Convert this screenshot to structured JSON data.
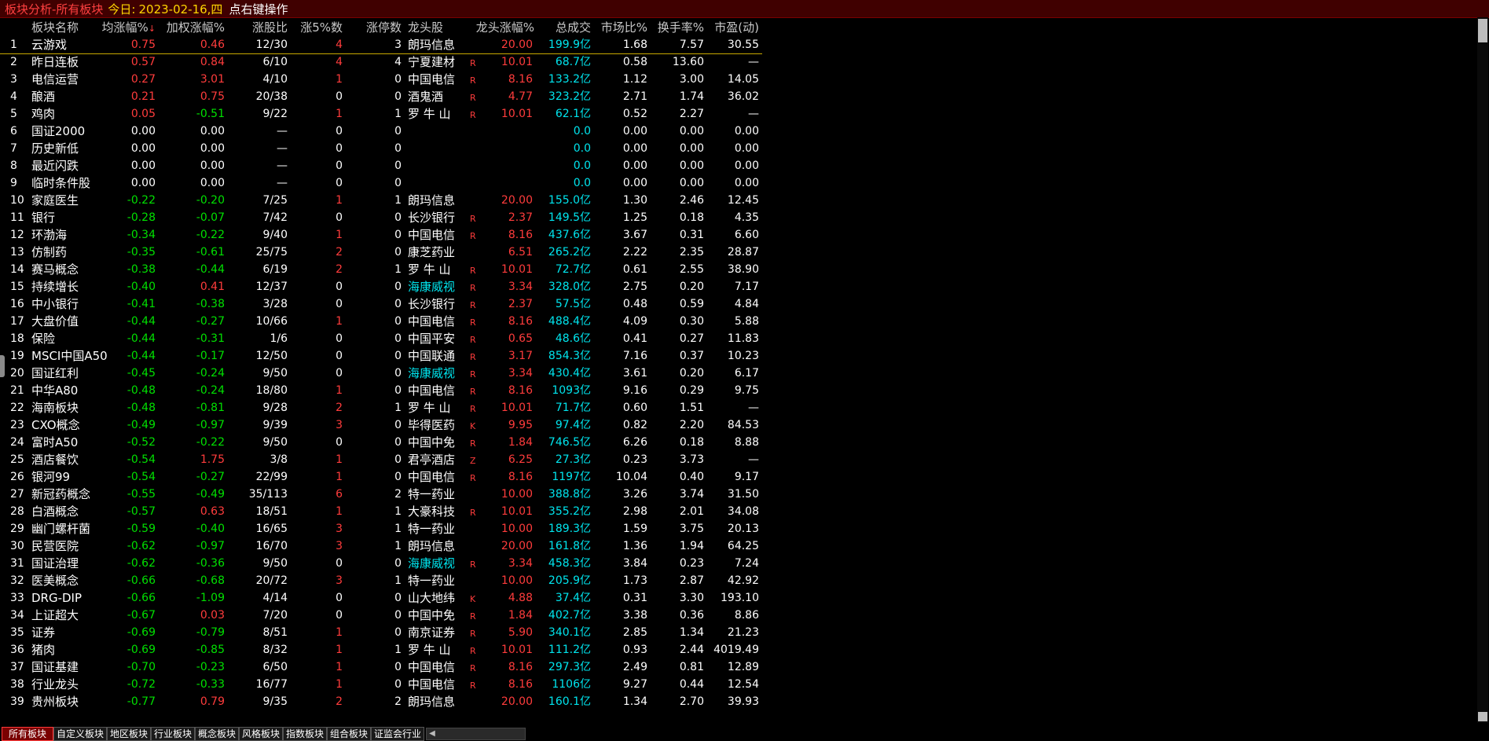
{
  "title": {
    "module": "板块分析-所有板块",
    "today_label": "今日:",
    "today_value": "2023-02-16,四",
    "hint": "点右键操作"
  },
  "columns": {
    "name": "板块名称",
    "avg": "均涨幅%",
    "weighted": "加权涨幅%",
    "ratio": "涨股比",
    "up5": "涨5%数",
    "limit_up": "涨停数",
    "leader": "龙头股",
    "leader_pct": "龙头涨幅%",
    "amount": "总成交",
    "mkt_ratio": "市场比%",
    "turnover": "换手率%",
    "pe": "市盈(动)"
  },
  "colors": {
    "up": "#ff3c3c",
    "down": "#00e000",
    "flat": "#ffffff",
    "amount": "#00e5ee",
    "leader_special": "#00e5ee"
  },
  "rows": [
    {
      "no": "1",
      "name": "云游戏",
      "avg": "0.75",
      "wgt": "0.46",
      "ratio": "12/30",
      "up5": "4",
      "lim": "3",
      "lead": "朗玛信息",
      "mark": "",
      "lpct": "20.00",
      "amt": "199.9亿",
      "mkt": "1.68",
      "turn": "7.57",
      "pe": "30.55"
    },
    {
      "no": "2",
      "name": "昨日连板",
      "avg": "0.57",
      "wgt": "0.84",
      "ratio": "6/10",
      "up5": "4",
      "lim": "4",
      "lead": "宁夏建材",
      "mark": "R",
      "lpct": "10.01",
      "amt": "68.7亿",
      "mkt": "0.58",
      "turn": "13.60",
      "pe": "—"
    },
    {
      "no": "3",
      "name": "电信运营",
      "avg": "0.27",
      "wgt": "3.01",
      "ratio": "4/10",
      "up5": "1",
      "lim": "0",
      "lead": "中国电信",
      "mark": "R",
      "lpct": "8.16",
      "amt": "133.2亿",
      "mkt": "1.12",
      "turn": "3.00",
      "pe": "14.05"
    },
    {
      "no": "4",
      "name": "酿酒",
      "avg": "0.21",
      "wgt": "0.75",
      "ratio": "20/38",
      "up5": "0",
      "lim": "0",
      "lead": "酒鬼酒",
      "mark": "R",
      "lpct": "4.77",
      "amt": "323.2亿",
      "mkt": "2.71",
      "turn": "1.74",
      "pe": "36.02"
    },
    {
      "no": "5",
      "name": "鸡肉",
      "avg": "0.05",
      "wgt": "-0.51",
      "ratio": "9/22",
      "up5": "1",
      "lim": "1",
      "lead": "罗 牛 山",
      "mark": "R",
      "lpct": "10.01",
      "amt": "62.1亿",
      "mkt": "0.52",
      "turn": "2.27",
      "pe": "—"
    },
    {
      "no": "6",
      "name": "国证2000",
      "avg": "0.00",
      "wgt": "0.00",
      "ratio": "—",
      "up5": "0",
      "lim": "0",
      "lead": "",
      "mark": "",
      "lpct": "",
      "amt": "0.0",
      "mkt": "0.00",
      "turn": "0.00",
      "pe": "0.00"
    },
    {
      "no": "7",
      "name": "历史新低",
      "avg": "0.00",
      "wgt": "0.00",
      "ratio": "—",
      "up5": "0",
      "lim": "0",
      "lead": "",
      "mark": "",
      "lpct": "",
      "amt": "0.0",
      "mkt": "0.00",
      "turn": "0.00",
      "pe": "0.00"
    },
    {
      "no": "8",
      "name": "最近闪跌",
      "avg": "0.00",
      "wgt": "0.00",
      "ratio": "—",
      "up5": "0",
      "lim": "0",
      "lead": "",
      "mark": "",
      "lpct": "",
      "amt": "0.0",
      "mkt": "0.00",
      "turn": "0.00",
      "pe": "0.00"
    },
    {
      "no": "9",
      "name": "临时条件股",
      "avg": "0.00",
      "wgt": "0.00",
      "ratio": "—",
      "up5": "0",
      "lim": "0",
      "lead": "",
      "mark": "",
      "lpct": "",
      "amt": "0.0",
      "mkt": "0.00",
      "turn": "0.00",
      "pe": "0.00"
    },
    {
      "no": "10",
      "name": "家庭医生",
      "avg": "-0.22",
      "wgt": "-0.20",
      "ratio": "7/25",
      "up5": "1",
      "lim": "1",
      "lead": "朗玛信息",
      "mark": "",
      "lpct": "20.00",
      "amt": "155.0亿",
      "mkt": "1.30",
      "turn": "2.46",
      "pe": "12.45"
    },
    {
      "no": "11",
      "name": "银行",
      "avg": "-0.28",
      "wgt": "-0.07",
      "ratio": "7/42",
      "up5": "0",
      "lim": "0",
      "lead": "长沙银行",
      "mark": "R",
      "lpct": "2.37",
      "amt": "149.5亿",
      "mkt": "1.25",
      "turn": "0.18",
      "pe": "4.35"
    },
    {
      "no": "12",
      "name": "环渤海",
      "avg": "-0.34",
      "wgt": "-0.22",
      "ratio": "9/40",
      "up5": "1",
      "lim": "0",
      "lead": "中国电信",
      "mark": "R",
      "lpct": "8.16",
      "amt": "437.6亿",
      "mkt": "3.67",
      "turn": "0.31",
      "pe": "6.60"
    },
    {
      "no": "13",
      "name": "仿制药",
      "avg": "-0.35",
      "wgt": "-0.61",
      "ratio": "25/75",
      "up5": "2",
      "lim": "0",
      "lead": "康芝药业",
      "mark": "",
      "lpct": "6.51",
      "amt": "265.2亿",
      "mkt": "2.22",
      "turn": "2.35",
      "pe": "28.87"
    },
    {
      "no": "14",
      "name": "赛马概念",
      "avg": "-0.38",
      "wgt": "-0.44",
      "ratio": "6/19",
      "up5": "2",
      "lim": "1",
      "lead": "罗 牛 山",
      "mark": "R",
      "lpct": "10.01",
      "amt": "72.7亿",
      "mkt": "0.61",
      "turn": "2.55",
      "pe": "38.90"
    },
    {
      "no": "15",
      "name": "持续增长",
      "avg": "-0.40",
      "wgt": "0.41",
      "ratio": "12/37",
      "up5": "0",
      "lim": "0",
      "lead": "海康威视",
      "mark": "R",
      "lpct": "3.34",
      "amt": "328.0亿",
      "mkt": "2.75",
      "turn": "0.20",
      "pe": "7.17"
    },
    {
      "no": "16",
      "name": "中小银行",
      "avg": "-0.41",
      "wgt": "-0.38",
      "ratio": "3/28",
      "up5": "0",
      "lim": "0",
      "lead": "长沙银行",
      "mark": "R",
      "lpct": "2.37",
      "amt": "57.5亿",
      "mkt": "0.48",
      "turn": "0.59",
      "pe": "4.84"
    },
    {
      "no": "17",
      "name": "大盘价值",
      "avg": "-0.44",
      "wgt": "-0.27",
      "ratio": "10/66",
      "up5": "1",
      "lim": "0",
      "lead": "中国电信",
      "mark": "R",
      "lpct": "8.16",
      "amt": "488.4亿",
      "mkt": "4.09",
      "turn": "0.30",
      "pe": "5.88"
    },
    {
      "no": "18",
      "name": "保险",
      "avg": "-0.44",
      "wgt": "-0.31",
      "ratio": "1/6",
      "up5": "0",
      "lim": "0",
      "lead": "中国平安",
      "mark": "R",
      "lpct": "0.65",
      "amt": "48.6亿",
      "mkt": "0.41",
      "turn": "0.27",
      "pe": "11.83"
    },
    {
      "no": "19",
      "name": "MSCI中国A50",
      "avg": "-0.44",
      "wgt": "-0.17",
      "ratio": "12/50",
      "up5": "0",
      "lim": "0",
      "lead": "中国联通",
      "mark": "R",
      "lpct": "3.17",
      "amt": "854.3亿",
      "mkt": "7.16",
      "turn": "0.37",
      "pe": "10.23"
    },
    {
      "no": "20",
      "name": "国证红利",
      "avg": "-0.45",
      "wgt": "-0.24",
      "ratio": "9/50",
      "up5": "0",
      "lim": "0",
      "lead": "海康威视",
      "mark": "R",
      "lpct": "3.34",
      "amt": "430.4亿",
      "mkt": "3.61",
      "turn": "0.20",
      "pe": "6.17"
    },
    {
      "no": "21",
      "name": "中华A80",
      "avg": "-0.48",
      "wgt": "-0.24",
      "ratio": "18/80",
      "up5": "1",
      "lim": "0",
      "lead": "中国电信",
      "mark": "R",
      "lpct": "8.16",
      "amt": "1093亿",
      "mkt": "9.16",
      "turn": "0.29",
      "pe": "9.75"
    },
    {
      "no": "22",
      "name": "海南板块",
      "avg": "-0.48",
      "wgt": "-0.81",
      "ratio": "9/28",
      "up5": "2",
      "lim": "1",
      "lead": "罗 牛 山",
      "mark": "R",
      "lpct": "10.01",
      "amt": "71.7亿",
      "mkt": "0.60",
      "turn": "1.51",
      "pe": "—"
    },
    {
      "no": "23",
      "name": "CXO概念",
      "avg": "-0.49",
      "wgt": "-0.97",
      "ratio": "9/39",
      "up5": "3",
      "lim": "0",
      "lead": "毕得医药",
      "mark": "K",
      "lpct": "9.95",
      "amt": "97.4亿",
      "mkt": "0.82",
      "turn": "2.20",
      "pe": "84.53"
    },
    {
      "no": "24",
      "name": "富时A50",
      "avg": "-0.52",
      "wgt": "-0.22",
      "ratio": "9/50",
      "up5": "0",
      "lim": "0",
      "lead": "中国中免",
      "mark": "R",
      "lpct": "1.84",
      "amt": "746.5亿",
      "mkt": "6.26",
      "turn": "0.18",
      "pe": "8.88"
    },
    {
      "no": "25",
      "name": "酒店餐饮",
      "avg": "-0.54",
      "wgt": "1.75",
      "ratio": "3/8",
      "up5": "1",
      "lim": "0",
      "lead": "君亭酒店",
      "mark": "Z",
      "lpct": "6.25",
      "amt": "27.3亿",
      "mkt": "0.23",
      "turn": "3.73",
      "pe": "—"
    },
    {
      "no": "26",
      "name": "银河99",
      "avg": "-0.54",
      "wgt": "-0.27",
      "ratio": "22/99",
      "up5": "1",
      "lim": "0",
      "lead": "中国电信",
      "mark": "R",
      "lpct": "8.16",
      "amt": "1197亿",
      "mkt": "10.04",
      "turn": "0.40",
      "pe": "9.17"
    },
    {
      "no": "27",
      "name": "新冠药概念",
      "avg": "-0.55",
      "wgt": "-0.49",
      "ratio": "35/113",
      "up5": "6",
      "lim": "2",
      "lead": "特一药业",
      "mark": "",
      "lpct": "10.00",
      "amt": "388.8亿",
      "mkt": "3.26",
      "turn": "3.74",
      "pe": "31.50"
    },
    {
      "no": "28",
      "name": "白酒概念",
      "avg": "-0.57",
      "wgt": "0.63",
      "ratio": "18/51",
      "up5": "1",
      "lim": "1",
      "lead": "大豪科技",
      "mark": "R",
      "lpct": "10.01",
      "amt": "355.2亿",
      "mkt": "2.98",
      "turn": "2.01",
      "pe": "34.08"
    },
    {
      "no": "29",
      "name": "幽门螺杆菌",
      "avg": "-0.59",
      "wgt": "-0.40",
      "ratio": "16/65",
      "up5": "3",
      "lim": "1",
      "lead": "特一药业",
      "mark": "",
      "lpct": "10.00",
      "amt": "189.3亿",
      "mkt": "1.59",
      "turn": "3.75",
      "pe": "20.13"
    },
    {
      "no": "30",
      "name": "民营医院",
      "avg": "-0.62",
      "wgt": "-0.97",
      "ratio": "16/70",
      "up5": "3",
      "lim": "1",
      "lead": "朗玛信息",
      "mark": "",
      "lpct": "20.00",
      "amt": "161.8亿",
      "mkt": "1.36",
      "turn": "1.94",
      "pe": "64.25"
    },
    {
      "no": "31",
      "name": "国证治理",
      "avg": "-0.62",
      "wgt": "-0.36",
      "ratio": "9/50",
      "up5": "0",
      "lim": "0",
      "lead": "海康威视",
      "mark": "R",
      "lpct": "3.34",
      "amt": "458.3亿",
      "mkt": "3.84",
      "turn": "0.23",
      "pe": "7.24"
    },
    {
      "no": "32",
      "name": "医美概念",
      "avg": "-0.66",
      "wgt": "-0.68",
      "ratio": "20/72",
      "up5": "3",
      "lim": "1",
      "lead": "特一药业",
      "mark": "",
      "lpct": "10.00",
      "amt": "205.9亿",
      "mkt": "1.73",
      "turn": "2.87",
      "pe": "42.92"
    },
    {
      "no": "33",
      "name": "DRG-DIP",
      "avg": "-0.66",
      "wgt": "-1.09",
      "ratio": "4/14",
      "up5": "0",
      "lim": "0",
      "lead": "山大地纬",
      "mark": "K",
      "lpct": "4.88",
      "amt": "37.4亿",
      "mkt": "0.31",
      "turn": "3.30",
      "pe": "193.10"
    },
    {
      "no": "34",
      "name": "上证超大",
      "avg": "-0.67",
      "wgt": "0.03",
      "ratio": "7/20",
      "up5": "0",
      "lim": "0",
      "lead": "中国中免",
      "mark": "R",
      "lpct": "1.84",
      "amt": "402.7亿",
      "mkt": "3.38",
      "turn": "0.36",
      "pe": "8.86"
    },
    {
      "no": "35",
      "name": "证券",
      "avg": "-0.69",
      "wgt": "-0.79",
      "ratio": "8/51",
      "up5": "1",
      "lim": "0",
      "lead": "南京证券",
      "mark": "R",
      "lpct": "5.90",
      "amt": "340.1亿",
      "mkt": "2.85",
      "turn": "1.34",
      "pe": "21.23"
    },
    {
      "no": "36",
      "name": "猪肉",
      "avg": "-0.69",
      "wgt": "-0.85",
      "ratio": "8/32",
      "up5": "1",
      "lim": "1",
      "lead": "罗 牛 山",
      "mark": "R",
      "lpct": "10.01",
      "amt": "111.2亿",
      "mkt": "0.93",
      "turn": "2.44",
      "pe": "4019.49"
    },
    {
      "no": "37",
      "name": "国证基建",
      "avg": "-0.70",
      "wgt": "-0.23",
      "ratio": "6/50",
      "up5": "1",
      "lim": "0",
      "lead": "中国电信",
      "mark": "R",
      "lpct": "8.16",
      "amt": "297.3亿",
      "mkt": "2.49",
      "turn": "0.81",
      "pe": "12.89"
    },
    {
      "no": "38",
      "name": "行业龙头",
      "avg": "-0.72",
      "wgt": "-0.33",
      "ratio": "16/77",
      "up5": "1",
      "lim": "0",
      "lead": "中国电信",
      "mark": "R",
      "lpct": "8.16",
      "amt": "1106亿",
      "mkt": "9.27",
      "turn": "0.44",
      "pe": "12.54"
    },
    {
      "no": "39",
      "name": "贵州板块",
      "avg": "-0.77",
      "wgt": "0.79",
      "ratio": "9/35",
      "up5": "2",
      "lim": "2",
      "lead": "朗玛信息",
      "mark": "",
      "lpct": "20.00",
      "amt": "160.1亿",
      "mkt": "1.34",
      "turn": "2.70",
      "pe": "39.93"
    }
  ],
  "tabs": [
    "所有板块",
    "自定义板块",
    "地区板块",
    "行业板块",
    "概念板块",
    "风格板块",
    "指数板块",
    "组合板块",
    "证监会行业"
  ],
  "active_tab": "所有板块",
  "icons": {
    "sort": "down-arrow-icon",
    "scroll_left": "left-arrow-icon"
  }
}
